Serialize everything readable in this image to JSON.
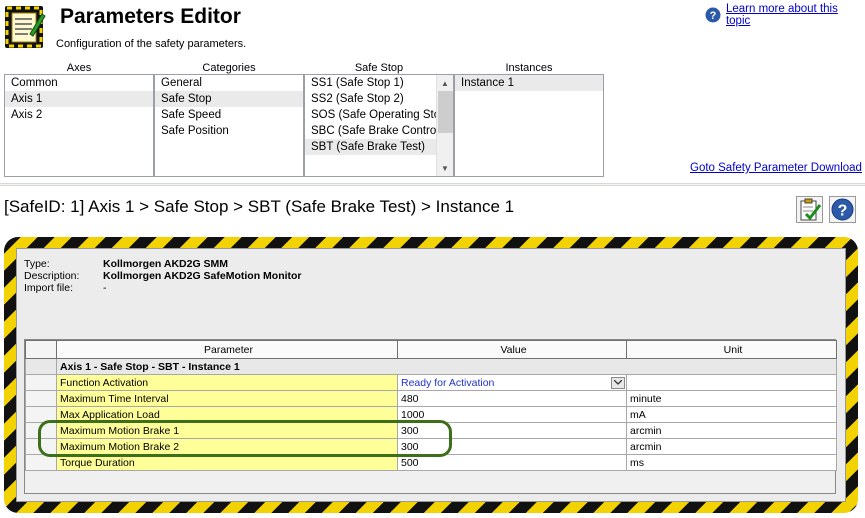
{
  "header": {
    "title": "Parameters Editor",
    "subtitle": "Configuration of the safety parameters.",
    "help_link": "Learn more about this topic"
  },
  "columns": {
    "axes": {
      "header": "Axes",
      "items": [
        "Common",
        "Axis 1",
        "Axis 2"
      ],
      "selected": "Axis 1"
    },
    "categories": {
      "header": "Categories",
      "items": [
        "General",
        "Safe Stop",
        "Safe Speed",
        "Safe Position"
      ],
      "selected": "Safe Stop"
    },
    "safe_stop": {
      "header": "Safe Stop",
      "items": [
        "SS1 (Safe Stop 1)",
        "SS2 (Safe Stop 2)",
        "SOS (Safe Operating Stop)",
        "SBC (Safe Brake Control)",
        "SBT (Safe Brake Test)"
      ],
      "selected": "SBT (Safe Brake Test)"
    },
    "instances": {
      "header": "Instances",
      "items": [
        "Instance 1"
      ],
      "selected": "Instance 1"
    }
  },
  "goto_link": "Goto Safety Parameter Download",
  "breadcrumb": "[SafeID: 1]  Axis 1 > Safe Stop > SBT (Safe Brake Test) > Instance 1",
  "toolbar": {
    "buttons": [
      "clipboard-check-icon",
      "help-icon"
    ]
  },
  "device_info": {
    "type_label": "Type:",
    "type_value": "Kollmorgen AKD2G SMM",
    "description_label": "Description:",
    "description_value": "Kollmorgen AKD2G SafeMotion Monitor",
    "import_label": "Import file:",
    "import_value": "-"
  },
  "grid": {
    "headers": {
      "parameter": "Parameter",
      "value": "Value",
      "unit": "Unit"
    },
    "group": "Axis 1 - Safe Stop - SBT - Instance 1",
    "rows": [
      {
        "parameter": "Function Activation",
        "value": "Ready for Activation",
        "unit": ""
      },
      {
        "parameter": "Maximum Time Interval",
        "value": "480",
        "unit": "minute"
      },
      {
        "parameter": "Max Application Load",
        "value": "1000",
        "unit": "mA"
      },
      {
        "parameter": "Maximum Motion Brake 1",
        "value": "300",
        "unit": "arcmin"
      },
      {
        "parameter": "Maximum Motion Brake 2",
        "value": "300",
        "unit": "arcmin"
      },
      {
        "parameter": "Torque Duration",
        "value": "500",
        "unit": "ms"
      }
    ]
  },
  "colors": {
    "link": "#0000cc",
    "hazard_yellow": "#f2d200",
    "param_cell": "#ffff99",
    "highlight_ring": "#3d6f1a",
    "dropdown_value": "#2032c8"
  }
}
